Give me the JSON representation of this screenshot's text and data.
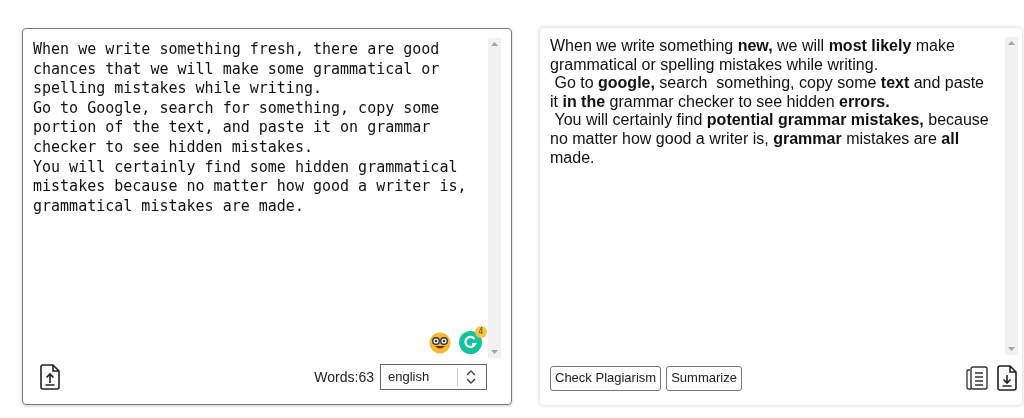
{
  "input_panel": {
    "lines": [
      "When we write something fresh, there are good chances that we will make some grammatical or spelling mistakes while writing.",
      "Go to Google, search for something, copy some portion of the text, and paste it on grammar checker to see hidden mistakes.",
      "You will certainly find some hidden grammatical mistakes because no matter how good a writer is, grammatical mistakes are made."
    ],
    "badge_count": "4",
    "word_count": "Words:63",
    "language": "english"
  },
  "output_panel": {
    "lines": [
      "When we write something **new,** we will **most likely** make grammatical or spelling mistakes while writing.",
      " Go to **google,** search  something, copy some **text** and paste it **in the** grammar checker to see hidden **errors.**",
      " You will certainly find **potential grammar mistakes,** because no matter how good a writer is, **grammar** mistakes are **all** made."
    ],
    "buttons": [
      "Check Plagiarism",
      "Summarize"
    ]
  }
}
